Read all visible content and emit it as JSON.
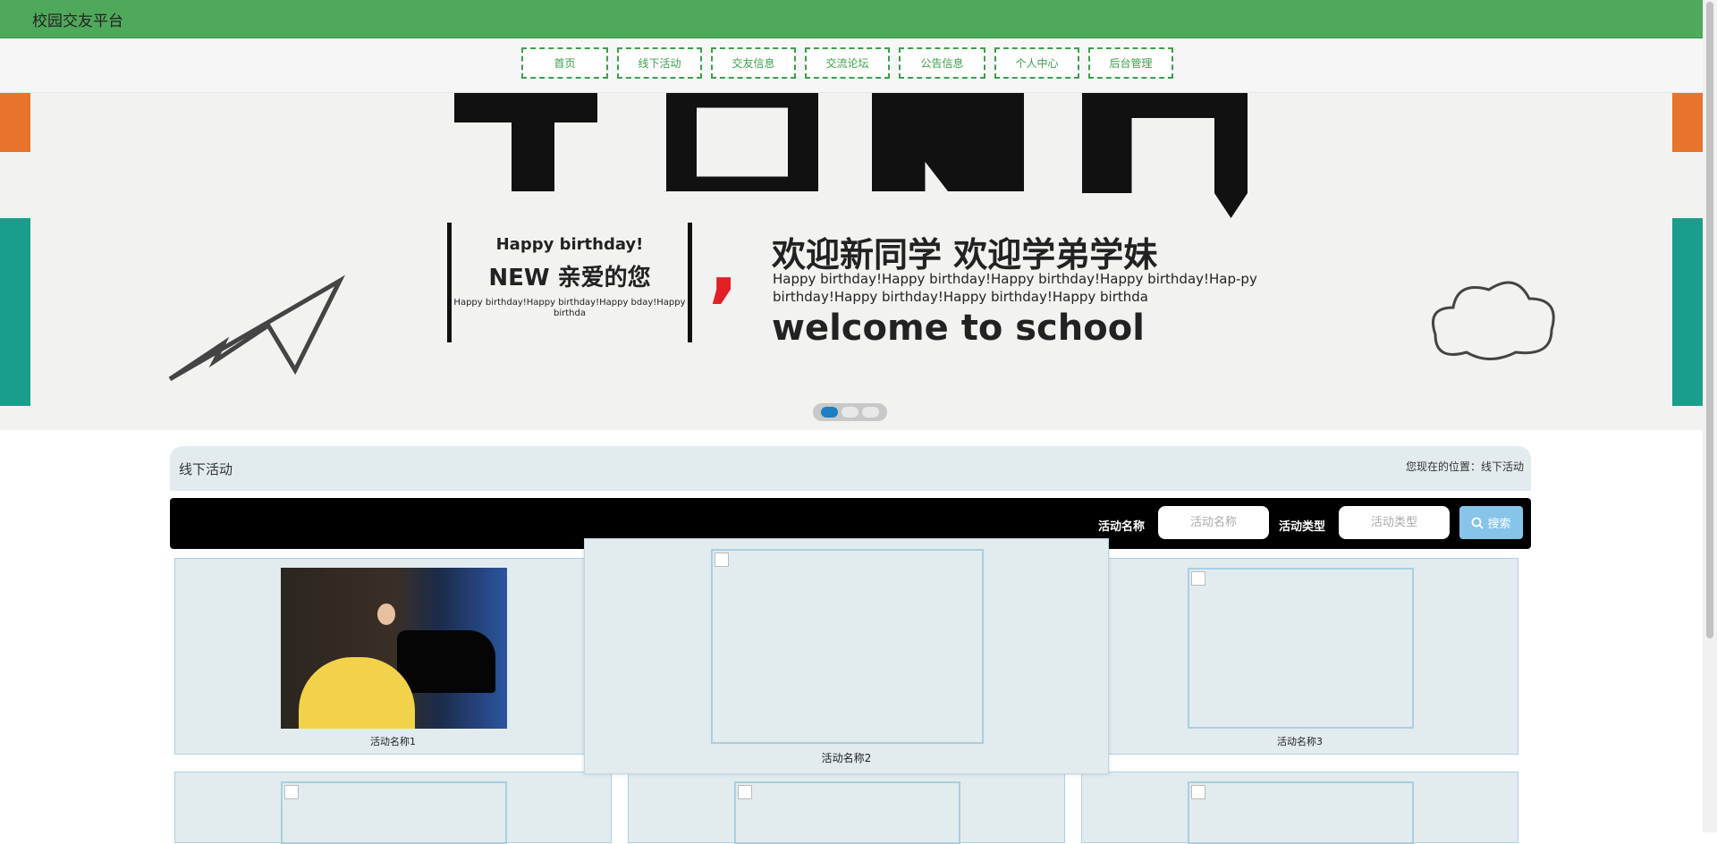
{
  "header": {
    "site_title": "校园交友平台"
  },
  "nav": {
    "items": [
      {
        "label": "首页"
      },
      {
        "label": "线下活动"
      },
      {
        "label": "交友信息"
      },
      {
        "label": "交流论坛"
      },
      {
        "label": "公告信息"
      },
      {
        "label": "个人中心"
      },
      {
        "label": "后台管理"
      }
    ]
  },
  "banner": {
    "birthday_title": "Happy birthday!",
    "new_text": "NEW 亲爱的您",
    "small_text": "Happy birthday!Happy birthday!Happy bday!Happy birthda",
    "welcome_cn": "欢迎新同学 欢迎学弟学妹",
    "welcome_repeat": "Happy birthday!Happy birthday!Happy birthday!Happy birthday!Hap-py birthday!Happy birthday!Happy birthday!Happy birthda",
    "welcome_en": "welcome to school",
    "slide_count": 3,
    "active_slide": 1
  },
  "location": {
    "section_title": "线下活动",
    "breadcrumb": "您现在的位置：线下活动"
  },
  "search": {
    "name_label": "活动名称",
    "name_placeholder": "活动名称",
    "type_label": "活动类型",
    "type_placeholder": "活动类型",
    "button_label": "搜索",
    "button_icon": "search-icon"
  },
  "cards": [
    {
      "name": "活动名称1"
    },
    {
      "name": "活动名称2"
    },
    {
      "name": "活动名称3"
    },
    {
      "name": ""
    },
    {
      "name": ""
    },
    {
      "name": ""
    }
  ],
  "colors": {
    "top_bar": "#4fa95b",
    "nav_border": "#3c9f4c",
    "card_bg": "#e2ebee",
    "search_button": "#86c4ea",
    "active_dot": "#1c7fc4"
  }
}
